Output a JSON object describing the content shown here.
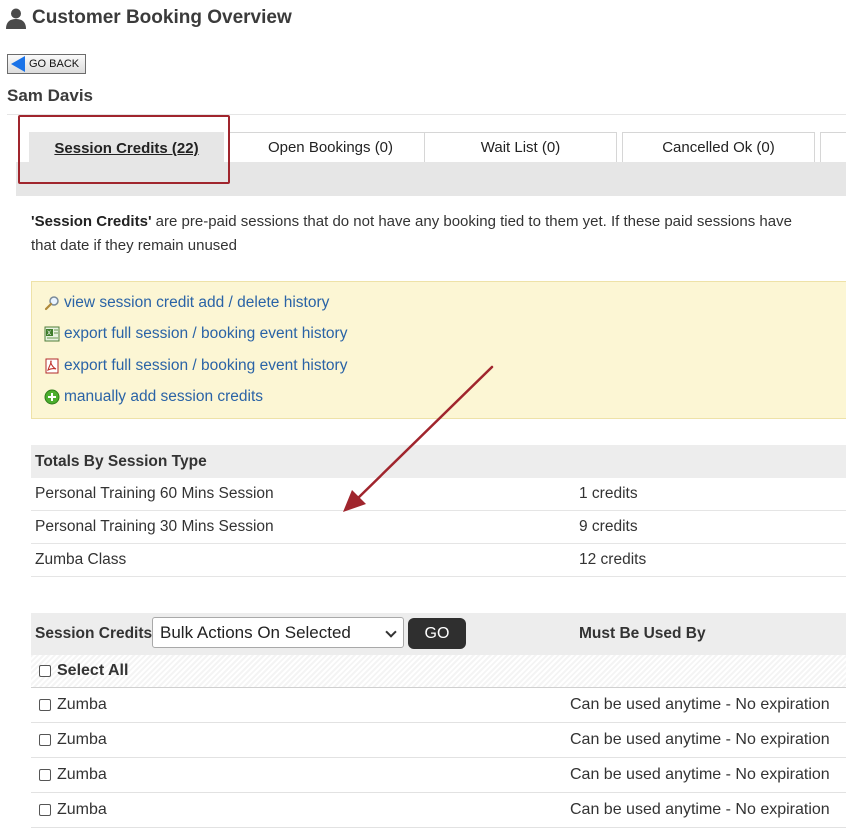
{
  "header": {
    "title": "Customer Booking Overview",
    "user_icon": "user-icon"
  },
  "go_back": {
    "label": "GO BACK"
  },
  "customer": {
    "name": "Sam Davis"
  },
  "tabs": [
    {
      "label": "Session Credits (22)",
      "active": true
    },
    {
      "label": "Open Bookings (0)"
    },
    {
      "label": "Wait List (0)"
    },
    {
      "label": "Cancelled Ok (0)"
    }
  ],
  "description": {
    "bold": "'Session Credits'",
    "line1_rest": " are pre-paid sessions that do not have any booking tied to them yet. If these paid sessions have",
    "line2": "that date if they remain unused"
  },
  "links": [
    {
      "label": "view session credit add / delete history",
      "icon": "magnifier-icon"
    },
    {
      "label": "export full session / booking event history",
      "icon": "excel-icon"
    },
    {
      "label": "export full session / booking event history",
      "icon": "pdf-icon"
    },
    {
      "label": "manually add session credits",
      "icon": "add-circle-icon"
    }
  ],
  "totals": {
    "heading": "Totals By Session Type",
    "rows": [
      {
        "type": "Personal Training 60 Mins Session",
        "credits": "1 credits"
      },
      {
        "type": "Personal Training 30 Mins Session",
        "credits": "9 credits"
      },
      {
        "type": "Zumba Class",
        "credits": "12 credits"
      }
    ]
  },
  "credits_table": {
    "heading": "Session Credits",
    "bulk_select": "Bulk Actions On Selected",
    "go_label": "GO",
    "must_use_heading": "Must Be Used By",
    "select_all": "Select All",
    "rows": [
      {
        "name": "Zumba",
        "expiry": "Can be used anytime - No expiration"
      },
      {
        "name": "Zumba",
        "expiry": "Can be used anytime - No expiration"
      },
      {
        "name": "Zumba",
        "expiry": "Can be used anytime - No expiration"
      },
      {
        "name": "Zumba",
        "expiry": "Can be used anytime - No expiration"
      }
    ]
  },
  "colors": {
    "highlight": "#a0252d",
    "link": "#2a63a6",
    "link_box_bg": "#fcf6d4",
    "go_button": "#2f2f2f"
  }
}
